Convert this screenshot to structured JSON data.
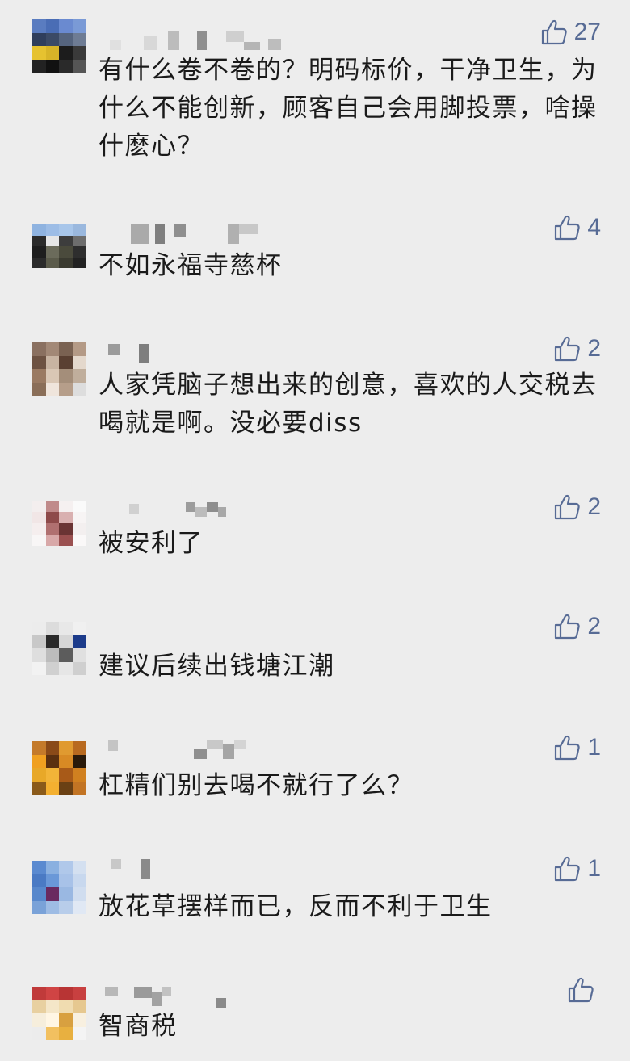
{
  "comments": [
    {
      "text": "有什么卷不卷的？明码标价，干净卫生，为什么不能创新，顾客自己会用脚投票，啥操什麽心？",
      "likes": "27"
    },
    {
      "text": "不如永福寺慈杯",
      "likes": "4"
    },
    {
      "text": "人家凭脑子想出来的创意，喜欢的人交税去喝就是啊。没必要diss",
      "likes": "2"
    },
    {
      "text": "被安利了",
      "likes": "2"
    },
    {
      "text": "建议后续出钱塘江潮",
      "likes": "2"
    },
    {
      "text": "杠精们别去喝不就行了么？",
      "likes": "1"
    },
    {
      "text": "放花草摆样而已，反而不利于卫生",
      "likes": "1"
    },
    {
      "text": "智商税",
      "likes": ""
    }
  ],
  "icons": {
    "like": "thumbs-up-icon",
    "avatar": "pixelated-avatar"
  },
  "colors": {
    "background": "#ededed",
    "text": "#1a1a1a",
    "like_accent": "#576b95"
  }
}
